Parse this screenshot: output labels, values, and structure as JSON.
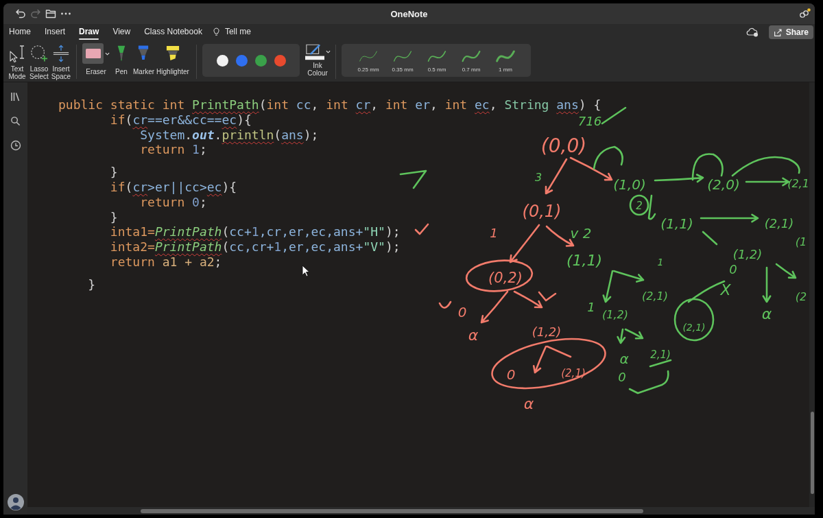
{
  "window": {
    "title": "OneNote"
  },
  "quick_actions": [
    {
      "kind": "undo",
      "disabled": false
    },
    {
      "kind": "redo",
      "disabled": true
    },
    {
      "kind": "open",
      "disabled": false
    },
    {
      "kind": "more",
      "disabled": false
    }
  ],
  "tabs": [
    {
      "label": "Home",
      "selected": false
    },
    {
      "label": "Insert",
      "selected": false
    },
    {
      "label": "Draw",
      "selected": true
    },
    {
      "label": "View",
      "selected": false
    },
    {
      "label": "Class Notebook",
      "selected": false
    }
  ],
  "tell_me": {
    "label": "Tell me"
  },
  "share_button": {
    "label": "Share"
  },
  "ribbon": {
    "modes": [
      {
        "kind": "text-mode",
        "label": "Text Mode",
        "selected": false
      },
      {
        "kind": "lasso",
        "label": "Lasso Select",
        "selected": false
      },
      {
        "kind": "insert-space",
        "label": "Insert Space",
        "selected": false
      }
    ],
    "pens": [
      {
        "kind": "eraser",
        "label": "Eraser",
        "selected": true,
        "dropdown": true,
        "color": "#e8a7b3"
      },
      {
        "kind": "pen",
        "label": "Pen",
        "selected": false,
        "dropdown": false,
        "color": "#3aa84a"
      },
      {
        "kind": "marker",
        "label": "Marker",
        "selected": false,
        "dropdown": false,
        "color": "#2d6fe6"
      },
      {
        "kind": "highlighter",
        "label": "Highlighter",
        "selected": false,
        "dropdown": false,
        "color": "#f2df45"
      }
    ],
    "ink_colours": [
      {
        "color": "#f2f2f2"
      },
      {
        "color": "#2f6ff0"
      },
      {
        "color": "#3aa14a"
      },
      {
        "color": "#e84a2e"
      }
    ],
    "ink_colour_button": {
      "label": "Ink Colour"
    },
    "thicknesses": [
      {
        "label": "0.25 mm"
      },
      {
        "label": "0.35 mm"
      },
      {
        "label": "0.5 mm"
      },
      {
        "label": "0.7 mm"
      },
      {
        "label": "1 mm"
      }
    ]
  },
  "page": {
    "code": [
      {
        "kind": "code",
        "tokens": [
          {
            "text": "public static int ",
            "kind": "keyword",
            "misspelled": false
          },
          {
            "text": "PrintPath",
            "kind": "function",
            "misspelled": true
          },
          {
            "text": "(",
            "kind": "punctuation",
            "misspelled": false
          },
          {
            "text": "int ",
            "kind": "keyword",
            "misspelled": false
          },
          {
            "text": "cc",
            "kind": "identifier",
            "misspelled": false
          },
          {
            "text": ", ",
            "kind": "punctuation",
            "misspelled": false
          },
          {
            "text": "int ",
            "kind": "keyword",
            "misspelled": false
          },
          {
            "text": "cr",
            "kind": "identifier",
            "misspelled": true
          },
          {
            "text": ", ",
            "kind": "punctuation",
            "misspelled": false
          },
          {
            "text": "int ",
            "kind": "keyword",
            "misspelled": false
          },
          {
            "text": "er",
            "kind": "identifier",
            "misspelled": false
          },
          {
            "text": ", ",
            "kind": "punctuation",
            "misspelled": false
          },
          {
            "text": "int ",
            "kind": "keyword",
            "misspelled": false
          },
          {
            "text": "ec",
            "kind": "identifier",
            "misspelled": true
          },
          {
            "text": ", ",
            "kind": "punctuation",
            "misspelled": false
          },
          {
            "text": "String ",
            "kind": "type",
            "misspelled": false
          },
          {
            "text": "ans",
            "kind": "identifier",
            "misspelled": true
          },
          {
            "text": ") {",
            "kind": "punctuation",
            "misspelled": false
          }
        ]
      },
      {
        "kind": "code",
        "tokens": [
          {
            "text": "       if",
            "kind": "keyword",
            "misspelled": false
          },
          {
            "text": "(",
            "kind": "punctuation",
            "misspelled": false
          },
          {
            "text": "cr",
            "kind": "identifier",
            "misspelled": true
          },
          {
            "text": "==er&&cc==",
            "kind": "identifier",
            "misspelled": false
          },
          {
            "text": "ec",
            "kind": "identifier",
            "misspelled": true
          },
          {
            "text": "){",
            "kind": "punctuation",
            "misspelled": false
          }
        ]
      },
      {
        "kind": "code",
        "tokens": [
          {
            "text": "           System",
            "kind": "identifier",
            "misspelled": false
          },
          {
            "text": ".",
            "kind": "punctuation",
            "misspelled": false
          },
          {
            "text": "out",
            "kind": "field",
            "misspelled": false
          },
          {
            "text": ".",
            "kind": "punctuation",
            "misspelled": false
          },
          {
            "text": "println",
            "kind": "method",
            "misspelled": true
          },
          {
            "text": "(",
            "kind": "punctuation",
            "misspelled": false
          },
          {
            "text": "ans",
            "kind": "identifier",
            "misspelled": true
          },
          {
            "text": ");",
            "kind": "punctuation",
            "misspelled": false
          }
        ]
      },
      {
        "kind": "code",
        "tokens": [
          {
            "text": "           return ",
            "kind": "keyword",
            "misspelled": false
          },
          {
            "text": "1",
            "kind": "number",
            "misspelled": false
          },
          {
            "text": ";",
            "kind": "punctuation",
            "misspelled": false
          }
        ]
      },
      {
        "kind": "blank"
      },
      {
        "kind": "code",
        "tokens": [
          {
            "text": "       }",
            "kind": "punctuation",
            "misspelled": false
          }
        ]
      },
      {
        "kind": "code",
        "tokens": [
          {
            "text": "       if",
            "kind": "keyword",
            "misspelled": false
          },
          {
            "text": "(",
            "kind": "punctuation",
            "misspelled": false
          },
          {
            "text": "cr",
            "kind": "identifier",
            "misspelled": true
          },
          {
            "text": ">er||cc>",
            "kind": "identifier",
            "misspelled": false
          },
          {
            "text": "ec",
            "kind": "identifier",
            "misspelled": true
          },
          {
            "text": "){",
            "kind": "punctuation",
            "misspelled": false
          }
        ]
      },
      {
        "kind": "code",
        "tokens": [
          {
            "text": "           return ",
            "kind": "keyword",
            "misspelled": false
          },
          {
            "text": "0",
            "kind": "number",
            "misspelled": false
          },
          {
            "text": ";",
            "kind": "punctuation",
            "misspelled": false
          }
        ]
      },
      {
        "kind": "code",
        "tokens": [
          {
            "text": "       }",
            "kind": "punctuation",
            "misspelled": false
          }
        ]
      },
      {
        "kind": "code",
        "tokens": [
          {
            "text": "       inta1=",
            "kind": "keyword",
            "misspelled": false
          },
          {
            "text": "PrintPath",
            "kind": "call",
            "misspelled": true
          },
          {
            "text": "(",
            "kind": "punctuation",
            "misspelled": false
          },
          {
            "text": "cc+",
            "kind": "identifier",
            "misspelled": false
          },
          {
            "text": "1",
            "kind": "number",
            "misspelled": false
          },
          {
            "text": ",cr,er,ec,ans+",
            "kind": "identifier",
            "misspelled": false
          },
          {
            "text": "\"H\"",
            "kind": "string",
            "misspelled": false
          },
          {
            "text": ");",
            "kind": "punctuation",
            "misspelled": false
          }
        ]
      },
      {
        "kind": "code",
        "tokens": [
          {
            "text": "       inta2=",
            "kind": "keyword",
            "misspelled": false
          },
          {
            "text": "PrintPath",
            "kind": "call",
            "misspelled": true
          },
          {
            "text": "(",
            "kind": "punctuation",
            "misspelled": false
          },
          {
            "text": "cc,cr+",
            "kind": "identifier",
            "misspelled": false
          },
          {
            "text": "1",
            "kind": "number",
            "misspelled": false
          },
          {
            "text": ",er,ec,ans+",
            "kind": "identifier",
            "misspelled": false
          },
          {
            "text": "\"V\"",
            "kind": "string",
            "misspelled": false
          },
          {
            "text": ");",
            "kind": "punctuation",
            "misspelled": false
          }
        ]
      },
      {
        "kind": "code",
        "tokens": [
          {
            "text": "       return ",
            "kind": "keyword",
            "misspelled": false
          },
          {
            "text": "a1 + a2",
            "kind": "local",
            "misspelled": false
          },
          {
            "text": ";",
            "kind": "punctuation",
            "misspelled": false
          }
        ]
      },
      {
        "kind": "blank"
      },
      {
        "kind": "code",
        "tokens": [
          {
            "text": "    }",
            "kind": "punctuation",
            "misspelled": false
          }
        ]
      }
    ],
    "ink": {
      "labels": [
        {
          "text": "(0,0)",
          "color": "#f27b6b"
        },
        {
          "text": "(0,1)",
          "color": "#f27b6b"
        },
        {
          "text": "1",
          "color": "#f27b6b"
        },
        {
          "text": "(0,2)",
          "color": "#f27b6b"
        },
        {
          "text": "0",
          "color": "#f27b6b"
        },
        {
          "text": "α",
          "color": "#f27b6b"
        },
        {
          "text": "(1,2)",
          "color": "#f27b6b"
        },
        {
          "text": "0",
          "color": "#f27b6b"
        },
        {
          "text": "α",
          "color": "#f27b6b"
        },
        {
          "text": "(2,1)",
          "color": "#f27b6b"
        },
        {
          "text": "716",
          "color": "#5ec35c"
        },
        {
          "text": "3",
          "color": "#5ec35c"
        },
        {
          "text": "(1,0)",
          "color": "#5ec35c"
        },
        {
          "text": "2",
          "color": "#5ec35c"
        },
        {
          "text": "(2,0)",
          "color": "#5ec35c"
        },
        {
          "text": "(2,1",
          "color": "#5ec35c"
        },
        {
          "text": "(1,1)",
          "color": "#5ec35c"
        },
        {
          "text": "(2,1)",
          "color": "#5ec35c"
        },
        {
          "text": "v 2",
          "color": "#5ec35c"
        },
        {
          "text": "(1,1)",
          "color": "#5ec35c"
        },
        {
          "text": "(1,2)",
          "color": "#5ec35c"
        },
        {
          "text": "0",
          "color": "#5ec35c"
        },
        {
          "text": "1",
          "color": "#5ec35c"
        },
        {
          "text": "(2,1)",
          "color": "#5ec35c"
        },
        {
          "text": "X",
          "color": "#5ec35c"
        },
        {
          "text": "1",
          "color": "#5ec35c"
        },
        {
          "text": "(1,2)",
          "color": "#5ec35c"
        },
        {
          "text": "(2,1)",
          "color": "#5ec35c"
        },
        {
          "text": "α",
          "color": "#5ec35c"
        },
        {
          "text": "(2",
          "color": "#5ec35c"
        },
        {
          "text": "α",
          "color": "#5ec35c"
        },
        {
          "text": "0",
          "color": "#5ec35c"
        },
        {
          "text": "2,1)",
          "color": "#5ec35c"
        },
        {
          "text": "(1",
          "color": "#5ec35c"
        }
      ],
      "strokes": [
        {
          "kind": "arrow",
          "color": "#f27b6b"
        },
        {
          "kind": "arrow",
          "color": "#f27b6b"
        },
        {
          "kind": "arrow",
          "color": "#f27b6b"
        },
        {
          "kind": "arrow",
          "color": "#f27b6b"
        },
        {
          "kind": "loop",
          "color": "#f27b6b"
        },
        {
          "kind": "arrow",
          "color": "#f27b6b"
        },
        {
          "kind": "arrow",
          "color": "#f27b6b"
        },
        {
          "kind": "stroke",
          "color": "#f27b6b"
        },
        {
          "kind": "stroke",
          "color": "#f27b6b"
        },
        {
          "kind": "loop",
          "color": "#f27b6b"
        },
        {
          "kind": "arrow",
          "color": "#f27b6b"
        },
        {
          "kind": "stroke",
          "color": "#f27b6b"
        },
        {
          "kind": "stroke",
          "color": "#f27b6b"
        },
        {
          "kind": "stroke",
          "color": "#5ec35c"
        },
        {
          "kind": "stroke",
          "color": "#5ec35c"
        },
        {
          "kind": "stroke",
          "color": "#5ec35c"
        },
        {
          "kind": "arrow",
          "color": "#5ec35c"
        },
        {
          "kind": "stroke",
          "color": "#5ec35c"
        },
        {
          "kind": "arrow",
          "color": "#5ec35c"
        },
        {
          "kind": "stroke",
          "color": "#5ec35c"
        },
        {
          "kind": "stroke",
          "color": "#5ec35c"
        },
        {
          "kind": "loop",
          "color": "#5ec35c"
        },
        {
          "kind": "arrow",
          "color": "#5ec35c"
        },
        {
          "kind": "stroke",
          "color": "#5ec35c"
        },
        {
          "kind": "arrow",
          "color": "#5ec35c"
        },
        {
          "kind": "arrow",
          "color": "#5ec35c"
        },
        {
          "kind": "loop",
          "color": "#5ec35c"
        },
        {
          "kind": "stroke",
          "color": "#5ec35c"
        },
        {
          "kind": "arrow",
          "color": "#5ec35c"
        },
        {
          "kind": "arrow",
          "color": "#5ec35c"
        },
        {
          "kind": "arrow",
          "color": "#5ec35c"
        },
        {
          "kind": "arrow",
          "color": "#5ec35c"
        },
        {
          "kind": "stroke",
          "color": "#5ec35c"
        },
        {
          "kind": "stroke",
          "color": "#5ec35c"
        }
      ]
    }
  }
}
